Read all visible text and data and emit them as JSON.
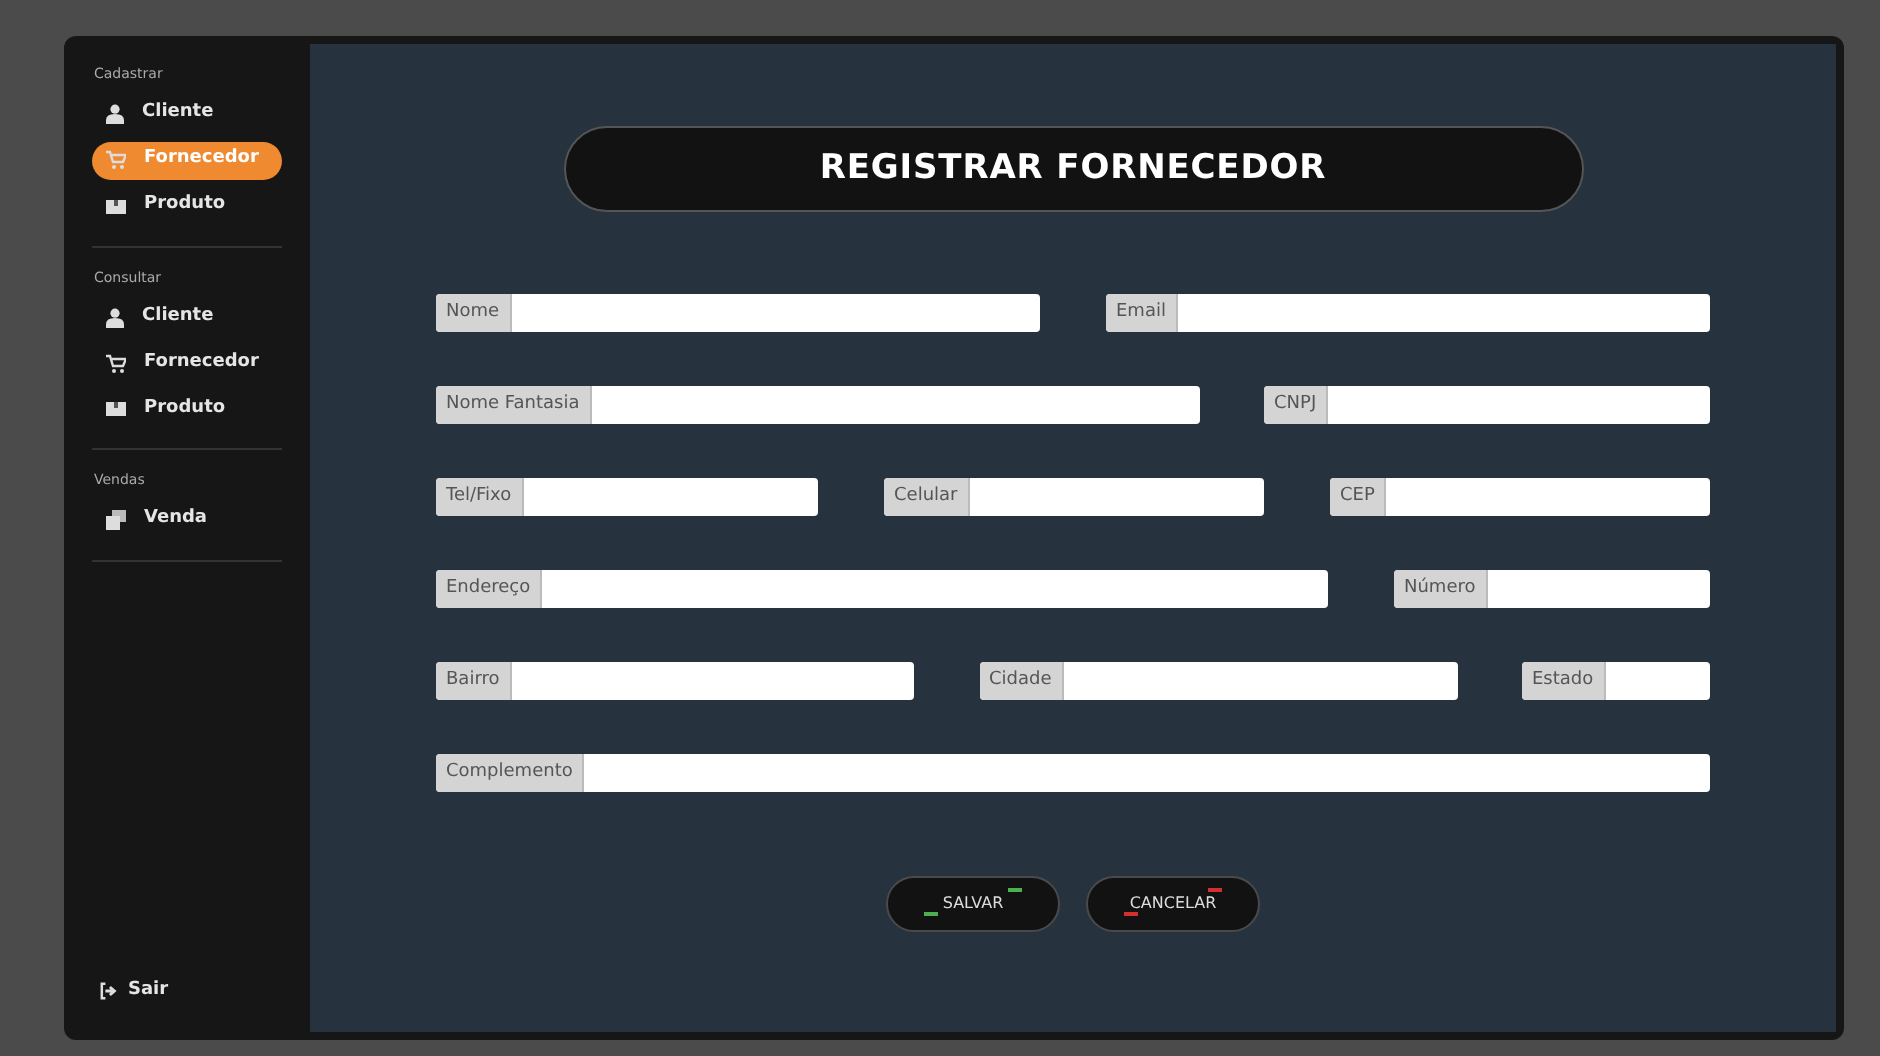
{
  "sidebar": {
    "sections": [
      {
        "title": "Cadastrar",
        "items": [
          {
            "kind": "user",
            "label": "Cliente",
            "selected": false
          },
          {
            "kind": "cart",
            "label": "Fornecedor",
            "selected": true
          },
          {
            "kind": "box",
            "label": "Produto",
            "selected": false
          }
        ]
      },
      {
        "title": "Consultar",
        "items": [
          {
            "kind": "user",
            "label": "Cliente",
            "selected": false
          },
          {
            "kind": "cart",
            "label": "Fornecedor",
            "selected": false
          },
          {
            "kind": "box",
            "label": "Produto",
            "selected": false
          }
        ]
      },
      {
        "title": "Vendas",
        "items": [
          {
            "kind": "stack",
            "label": "Venda",
            "selected": false
          }
        ]
      }
    ],
    "logout": {
      "label": "Sair"
    }
  },
  "form": {
    "title": "REGISTRAR FORNECEDOR",
    "rows": [
      [
        {
          "label": "Nome"
        },
        {
          "label": "Email"
        }
      ],
      [
        {
          "label": "Nome Fantasia"
        },
        {
          "label": "CNPJ"
        }
      ],
      [
        {
          "label": "Tel/Fixo"
        },
        {
          "label": "Celular"
        },
        {
          "label": "CEP"
        }
      ],
      [
        {
          "label": "Endereço"
        },
        {
          "label": "Número"
        }
      ],
      [
        {
          "label": "Bairro"
        },
        {
          "label": "Cidade"
        },
        {
          "label": "Estado"
        }
      ],
      [
        {
          "label": "Complemento"
        }
      ]
    ],
    "buttons": [
      {
        "label": "SALVAR",
        "color": "#4caf50"
      },
      {
        "label": "CANCELAR",
        "color": "#d32f2f"
      }
    ]
  }
}
